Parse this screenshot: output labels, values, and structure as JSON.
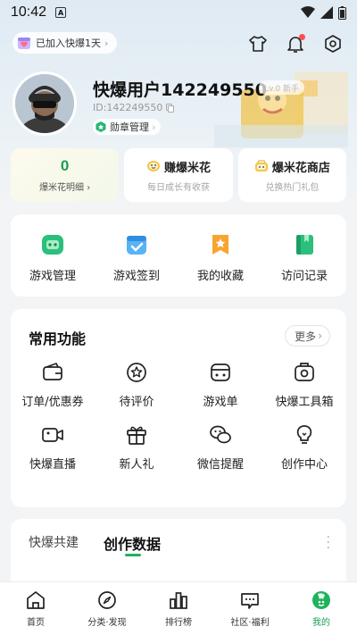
{
  "status_bar": {
    "time": "10:42",
    "notice_glyph": "A"
  },
  "top": {
    "join_badge": "已加入快爆1天",
    "icons": [
      "shirt-icon",
      "bell-icon",
      "settings-icon"
    ]
  },
  "profile": {
    "username": "快爆用户142249550",
    "level_tag": "Lv.0 新手",
    "user_id": "ID:142249550",
    "medal_label": "勋章管理"
  },
  "popcorn_cards": [
    {
      "value": "0",
      "sub": "爆米花明细 ›"
    },
    {
      "title": "赚爆米花",
      "sub": "每日成长有收获"
    },
    {
      "title": "爆米花商店",
      "sub": "兑换热门礼包"
    }
  ],
  "game_items": [
    {
      "label": "游戏管理",
      "icon": "gamepad-icon"
    },
    {
      "label": "游戏签到",
      "icon": "checkin-icon"
    },
    {
      "label": "我的收藏",
      "icon": "star-bookmark-icon"
    },
    {
      "label": "访问记录",
      "icon": "history-icon"
    }
  ],
  "common_functions": {
    "title": "常用功能",
    "more_label": "更多",
    "items": [
      {
        "label": "订单/优惠券",
        "icon": "wallet-icon"
      },
      {
        "label": "待评价",
        "icon": "review-icon"
      },
      {
        "label": "游戏单",
        "icon": "gamelist-icon"
      },
      {
        "label": "快爆工具箱",
        "icon": "toolbox-icon"
      },
      {
        "label": "快爆直播",
        "icon": "live-camera-icon"
      },
      {
        "label": "新人礼",
        "icon": "gift-icon"
      },
      {
        "label": "微信提醒",
        "icon": "wechat-icon"
      },
      {
        "label": "创作中心",
        "icon": "bulb-icon"
      }
    ]
  },
  "creation": {
    "tabs": [
      "快爆共建",
      "创作数据"
    ],
    "active_tab": 1
  },
  "bottom_nav": [
    {
      "label": "首页",
      "icon": "home-icon"
    },
    {
      "label": "分类·发现",
      "icon": "compass-icon"
    },
    {
      "label": "排行榜",
      "icon": "ranking-icon"
    },
    {
      "label": "社区·福利",
      "icon": "community-icon"
    },
    {
      "label": "我的",
      "icon": "profile-icon",
      "active": true
    }
  ],
  "colors": {
    "brand_green": "#1aa052",
    "bg": "#f3f4f6",
    "card": "#ffffff"
  }
}
